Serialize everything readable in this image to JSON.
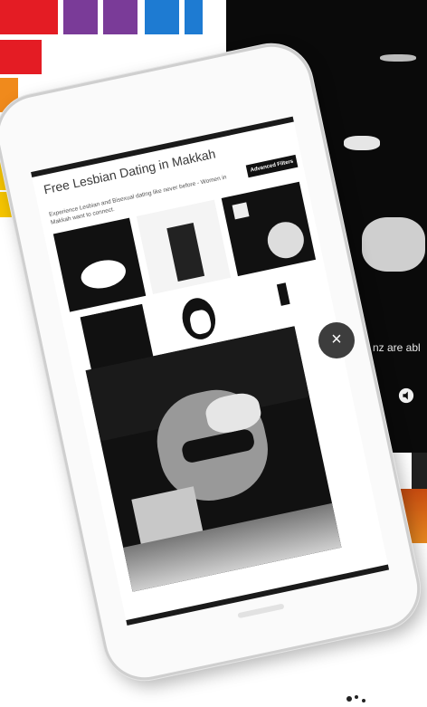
{
  "background": {
    "caption": "nz are abl",
    "tile_colors": [
      "#e41c24",
      "#7a3b98",
      "#1e7bd2",
      "#f6c500",
      "#f08a1c",
      "#ffffff"
    ]
  },
  "site": {
    "title": "Free Lesbian Dating in Makkah",
    "subtitle": "Experience Lesbian and Bisexual dating like never before - Women in Makkah want to connect.",
    "advanced_filters_label": "Advanced Filters"
  },
  "close_button": {
    "symbol": "×"
  },
  "icons": {
    "speaker": "speaker-icon",
    "close": "close-icon"
  }
}
